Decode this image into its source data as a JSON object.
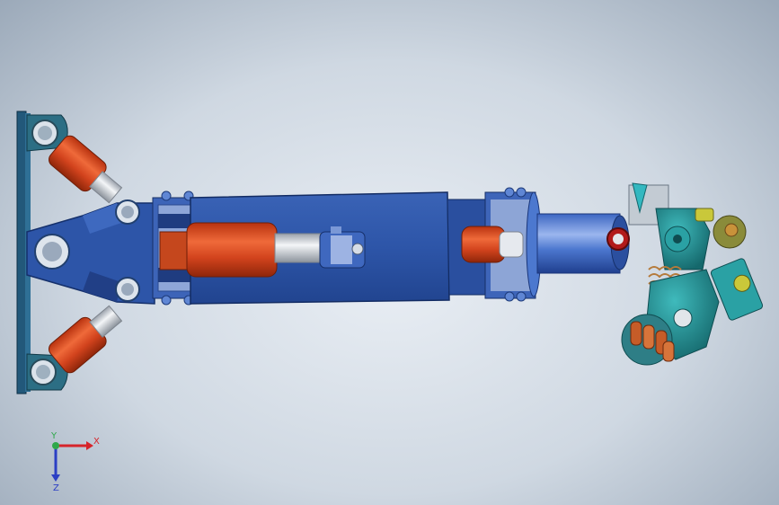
{
  "view": {
    "background_top": "#e9eef4",
    "background_edge": "#9ba9b9"
  },
  "colors": {
    "frame_blue": "#2d55a8",
    "frame_blue_dark": "#1e3f86",
    "frame_blue_light": "#4a74c6",
    "bracket_teal": "#2c6e84",
    "cylinder_orange": "#d2431d",
    "cylinder_orange_dark": "#9c2a0c",
    "rod_silver": "#d9dde3",
    "gear_teal": "#2a9a9c",
    "gear_teal_dark": "#176a6e",
    "pin_light": "#b9c7e6",
    "accent_yellow": "#c9c83a",
    "accent_olive": "#8a8b3a"
  },
  "triad": {
    "x_label": "X",
    "y_label": "Y",
    "z_label": "Z",
    "x_color": "#d6242a",
    "y_color": "#2ea84a",
    "z_color": "#2b3fc4"
  }
}
